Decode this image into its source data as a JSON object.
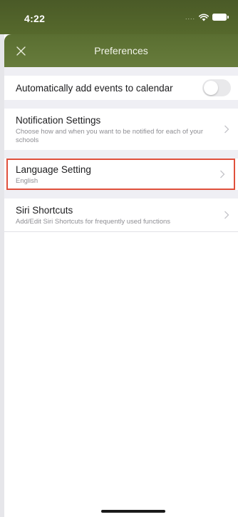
{
  "status_bar": {
    "time": "4:22",
    "signal_dots": "....",
    "icons": [
      "wifi-icon",
      "battery-icon"
    ]
  },
  "nav": {
    "title": "Preferences",
    "close_icon": "close-icon"
  },
  "settings": {
    "auto_add_events": {
      "label": "Automatically add events to calendar",
      "toggle_on": false
    },
    "notification": {
      "title": "Notification Settings",
      "subtitle": "Choose how and when you want to be notified for each of your schools"
    },
    "language": {
      "title": "Language Setting",
      "value": "English"
    },
    "siri": {
      "title": "Siri Shortcuts",
      "subtitle": "Add/Edit Siri Shortcuts for frequently used functions"
    }
  },
  "colors": {
    "header_green": "#56692c",
    "highlight_border": "#e0503c",
    "group_gap": "#efeff4"
  }
}
